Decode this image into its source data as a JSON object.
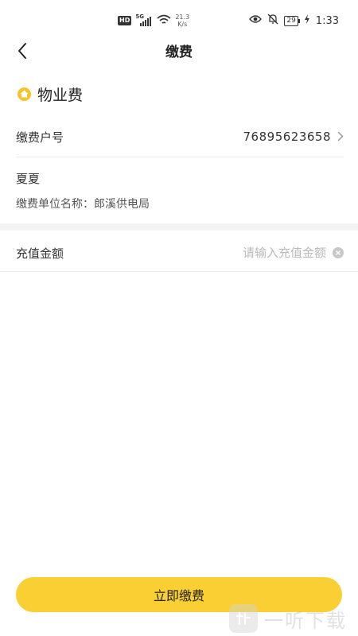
{
  "status_bar": {
    "hd_badge": "HD",
    "network_label": "5G",
    "speed_value": "21.3",
    "speed_unit": "K/s",
    "battery_level": "29",
    "time": "1:33"
  },
  "nav": {
    "title": "缴费"
  },
  "section": {
    "title": "物业费",
    "icon": "home-icon",
    "icon_color": "#f5c52a"
  },
  "account": {
    "label": "缴费户号",
    "value": "76895623658"
  },
  "payer": {
    "name": "夏夏",
    "unit_label": "缴费单位名称：",
    "unit_value": "郎溪供电局"
  },
  "amount": {
    "label": "充值金额",
    "placeholder": "请输入充值金额",
    "value": ""
  },
  "actions": {
    "pay_label": "立即缴费",
    "pay_color": "#f9cf33"
  },
  "watermark": {
    "text": "一听下载"
  }
}
